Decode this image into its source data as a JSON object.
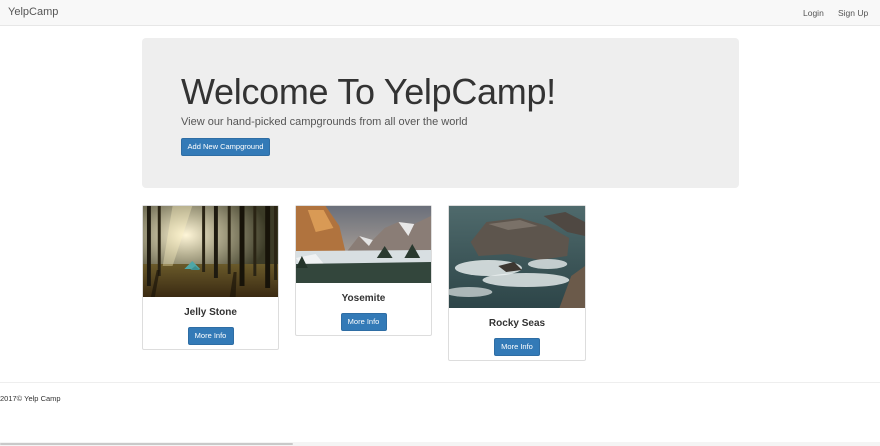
{
  "navbar": {
    "brand": "YelpCamp",
    "links": {
      "login": "Login",
      "signup": "Sign Up"
    }
  },
  "jumbotron": {
    "title": "Welcome To YelpCamp!",
    "subtitle": "View our hand-picked campgrounds from all over the world",
    "button_label": "Add New Campground"
  },
  "campgrounds": [
    {
      "name": "Jelly Stone",
      "button_label": "More Info",
      "image": "forest-campsite-photo"
    },
    {
      "name": "Yosemite",
      "button_label": "More Info",
      "image": "yosemite-valley-photo"
    },
    {
      "name": "Rocky Seas",
      "button_label": "More Info",
      "image": "rocky-coast-photo"
    }
  ],
  "footer": {
    "text": "2017© Yelp Camp"
  },
  "colors": {
    "primary": "#337ab7",
    "jumbotron_bg": "#eeeeee",
    "navbar_bg": "#f8f8f8"
  }
}
